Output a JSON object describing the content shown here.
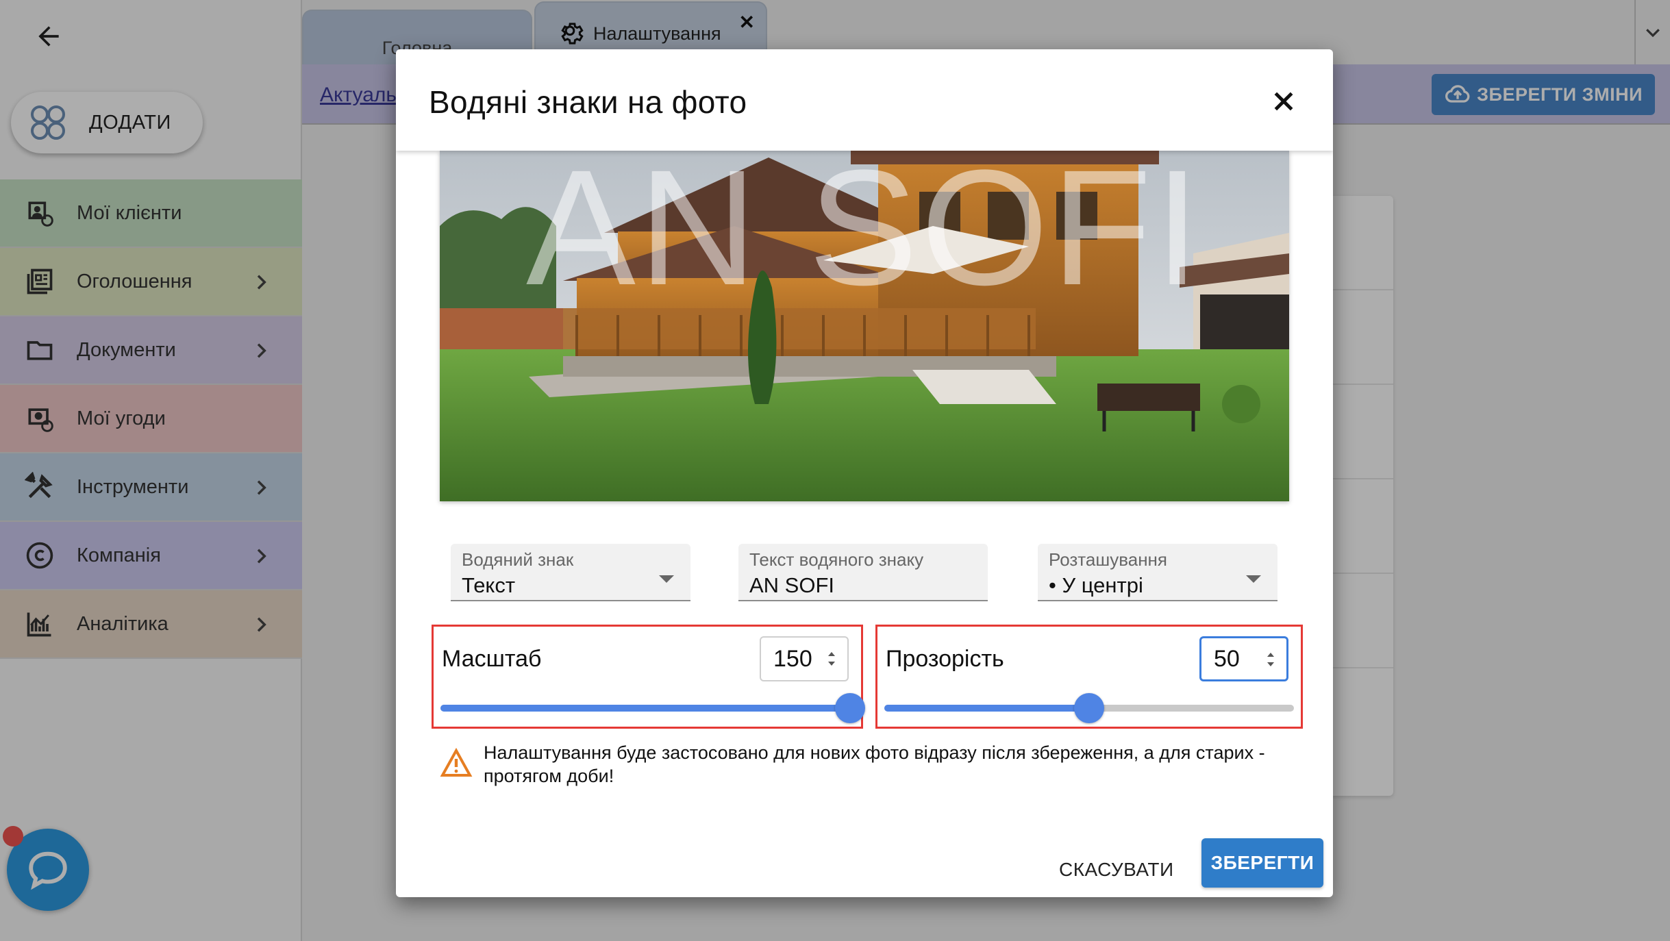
{
  "sidebar": {
    "add_label": "ДОДАТИ",
    "items": [
      {
        "label": "Мої клієнти",
        "color": "#c7e2c6",
        "icon": "clients-icon",
        "chevron": false
      },
      {
        "label": "Оголошення",
        "color": "#dfe6c2",
        "icon": "listings-icon",
        "chevron": true
      },
      {
        "label": "Документи",
        "color": "#d6cde8",
        "icon": "folder-icon",
        "chevron": true
      },
      {
        "label": "Мої угоди",
        "color": "#efc7c7",
        "icon": "deals-icon",
        "chevron": false
      },
      {
        "label": "Інструменти",
        "color": "#c5d6e8",
        "icon": "tools-icon",
        "chevron": true
      },
      {
        "label": "Компанія",
        "color": "#cdcaf0",
        "icon": "copyright-icon",
        "chevron": true
      },
      {
        "label": "Аналітика",
        "color": "#e8d8c8",
        "icon": "analytics-icon",
        "chevron": true
      }
    ]
  },
  "tabs": {
    "home": "Головна",
    "settings": "Налаштування"
  },
  "subbar": {
    "link": "Актуаль",
    "save_changes": "ЗБЕРЕГТИ ЗМІНИ"
  },
  "dialog": {
    "title": "Водяні знаки на фото",
    "watermark_preview_text": "AN SOFI",
    "fields": {
      "watermark": {
        "label": "Водяний знак",
        "value": "Текст"
      },
      "watermark_text": {
        "label": "Текст водяного знаку",
        "value": "AN SOFI"
      },
      "position": {
        "label": "Розташування",
        "value": "• У центрі"
      }
    },
    "scale": {
      "label": "Масштаб",
      "value": "150",
      "fraction": 1.0
    },
    "opacity": {
      "label": "Прозорість",
      "value": "50",
      "fraction": 0.5
    },
    "warning": "Налаштування буде застосовано для нових фото відразу після збереження, а для старих - протягом доби!",
    "cancel": "СКАСУВАТИ",
    "save": "ЗБЕРЕГТИ"
  },
  "colors": {
    "accent": "#2f7dc9",
    "slider": "#4f84e4",
    "highlight": "#e53935",
    "warning": "#e67e22"
  }
}
